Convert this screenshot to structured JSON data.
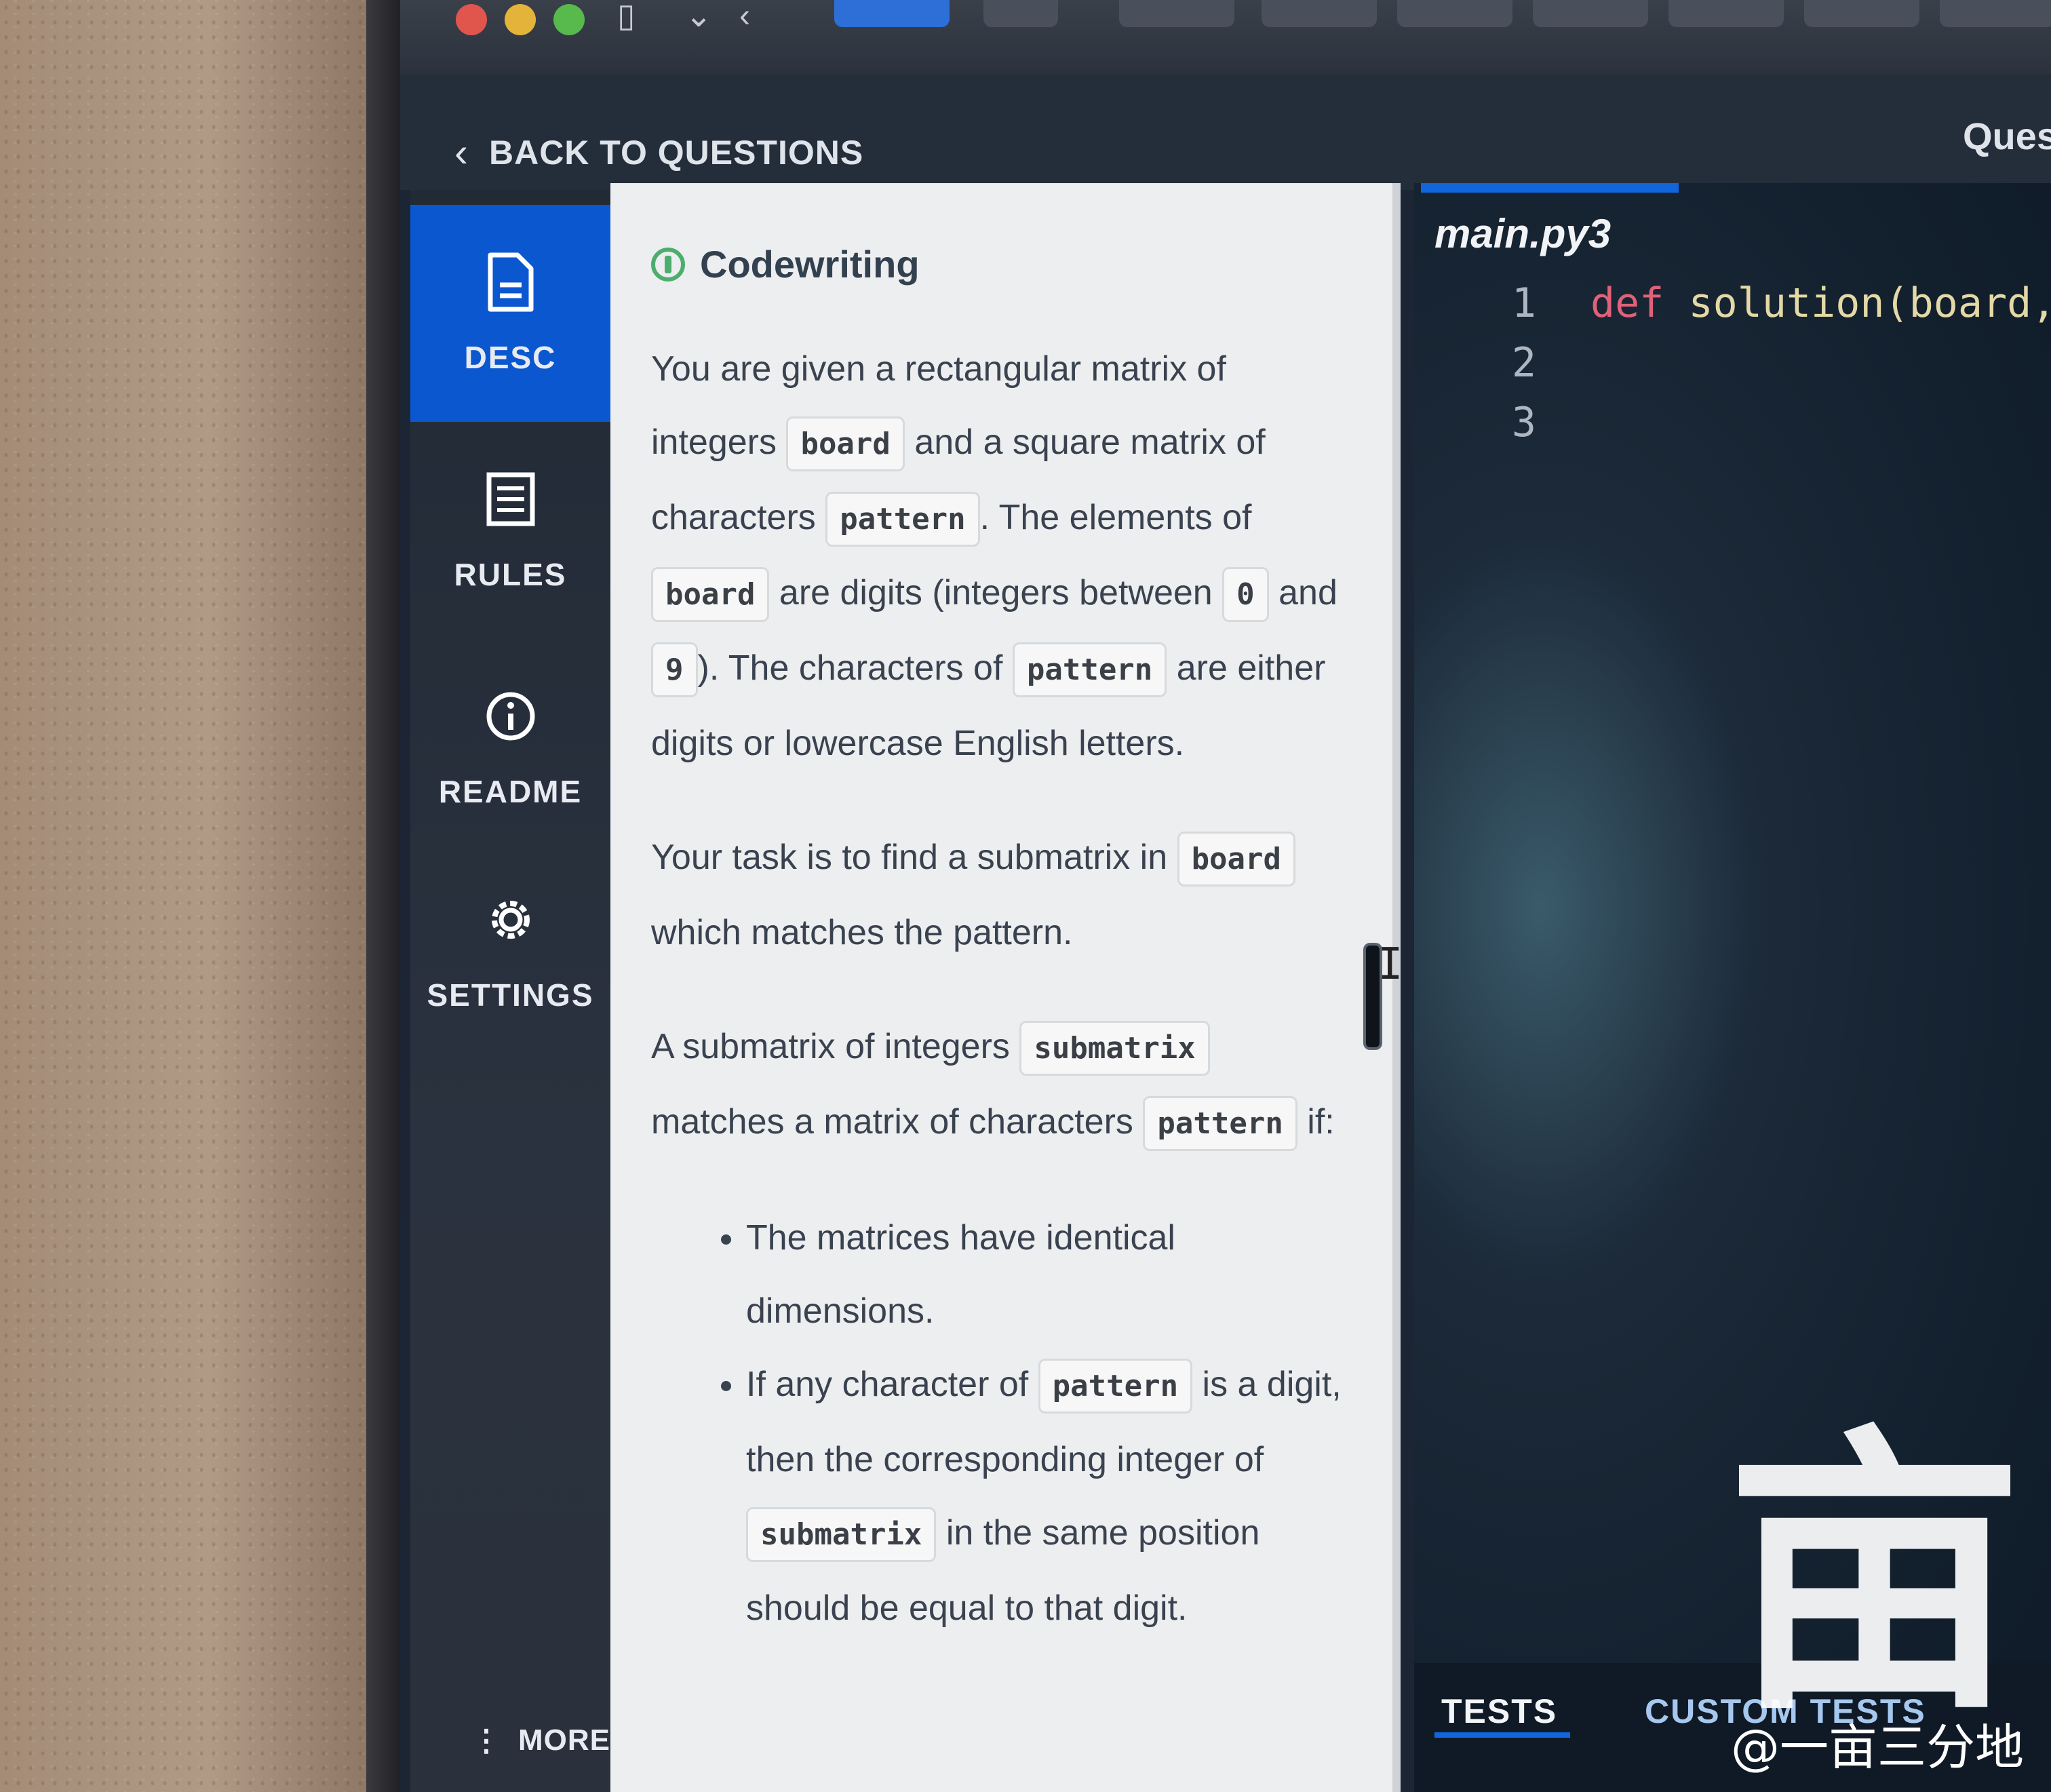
{
  "header": {
    "back_label": "BACK TO QUESTIONS",
    "right_title": "Ques"
  },
  "sidebar": {
    "items": [
      {
        "label": "DESC",
        "icon": "document-icon",
        "active": true
      },
      {
        "label": "RULES",
        "icon": "list-icon",
        "active": false
      },
      {
        "label": "README",
        "icon": "info-icon",
        "active": false
      },
      {
        "label": "SETTINGS",
        "icon": "gear-icon",
        "active": false
      }
    ],
    "more_label": "MORE"
  },
  "problem": {
    "type_label": "Codewriting",
    "p1": {
      "t1": "You are given a rectangular matrix of integers",
      "c1": "board",
      "t2": "and a square matrix of characters",
      "c2": "pattern",
      "t3": ". The elements of",
      "c3": "board",
      "t4": "are digits (integers between",
      "c4": "0",
      "t5": "and",
      "c5": "9",
      "t6": "). The characters of",
      "c6": "pattern",
      "t7": "are either digits or lowercase English letters."
    },
    "p2": {
      "t1": "Your task is to find a submatrix in",
      "c1": "board",
      "t2": "which matches the pattern."
    },
    "p3": {
      "t1": "A submatrix of integers",
      "c1": "submatrix",
      "t2": "matches a matrix of characters",
      "c2": "pattern",
      "t3": "if:"
    },
    "bullets": {
      "b1": "The matrices have identical dimensions.",
      "b2_t1": "If any character of",
      "b2_c1": "pattern",
      "b2_t2": "is a digit, then the corresponding integer of",
      "b2_c2": "submatrix",
      "b2_t3": "in the same position should be equal to that",
      "b2_t4": "digit."
    }
  },
  "editor": {
    "filename": "main.py3",
    "line_numbers": [
      "1",
      "2",
      "3"
    ],
    "line1_kw": "def",
    "line1_rest": "solution(board,"
  },
  "bottom_tabs": {
    "tests": "TESTS",
    "custom_tests": "CUSTOM TESTS"
  },
  "watermark": {
    "glyph": "亩",
    "text": "@一亩三分地"
  },
  "colors": {
    "accent_blue": "#0b57d0",
    "keyword": "#e0627a",
    "badge_green": "#4cae6e"
  }
}
